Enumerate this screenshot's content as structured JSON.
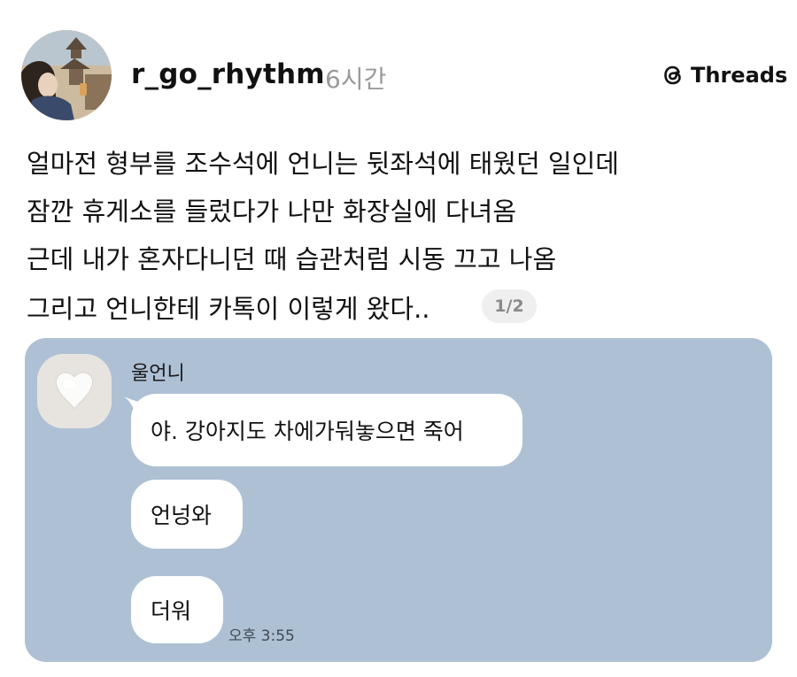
{
  "header": {
    "username": "r_go_rhythm",
    "time": "6시간",
    "brand": "Threads",
    "brand_icon": "threads-logo-icon",
    "avatar_icon": "profile-avatar-image"
  },
  "post": {
    "lines": [
      "얼마전 형부를 조수석에 언니는 뒷좌석에 태웠던 일인데",
      "잠깐 휴게소를 들렀다가 나만 화장실에 다녀옴",
      "근데 내가 혼자다니던 때 습관처럼 시동 끄고 나옴",
      "그리고 언니한테 카톡이 이렇게 왔다.."
    ],
    "pager": "1/2"
  },
  "chat": {
    "background": "#aec0d4",
    "sender": "울언니",
    "avatar_icon": "cotton-avatar-image",
    "messages": [
      "야. 강아지도 차에가둬놓으면 죽어",
      "언넝와",
      "더워"
    ],
    "timestamp": "오후 3:55"
  }
}
